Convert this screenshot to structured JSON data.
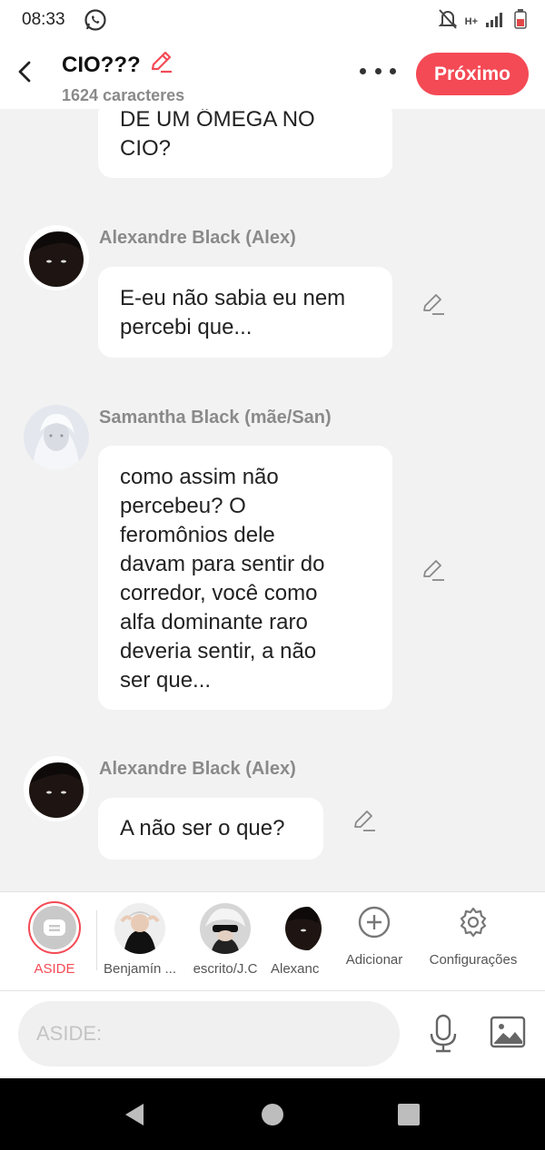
{
  "status_bar": {
    "time": "08:33",
    "network": "H+"
  },
  "header": {
    "title": "CIO???",
    "subtitle": "1624 caracteres",
    "next_label": "Próximo"
  },
  "messages": [
    {
      "speaker": "",
      "lines": [
        "DE UM ÖMEGA NO",
        "CIO?"
      ]
    },
    {
      "speaker": "Alexandre Black (Alex)",
      "lines": [
        "E-eu não sabia eu nem",
        "percebi que..."
      ]
    },
    {
      "speaker": "Samantha Black (mãe/San)",
      "lines": [
        "como assim não",
        "percebeu? O",
        "feromônios dele",
        "davam para sentir do",
        "corredor, você como",
        "alfa dominante raro",
        "deveria sentir, a não",
        "ser que..."
      ]
    },
    {
      "speaker": "Alexandre Black (Alex)",
      "lines": [
        "A não ser o que?"
      ]
    }
  ],
  "characters": {
    "aside": "ASIDE",
    "items": [
      "Benjamín ...",
      "escrito/J.C",
      "Alexanc"
    ],
    "add_label": "Adicionar",
    "settings_label": "Configurações"
  },
  "input": {
    "placeholder": "ASIDE:"
  },
  "colors": {
    "accent": "#f44a55",
    "background": "#f2f2f2"
  }
}
